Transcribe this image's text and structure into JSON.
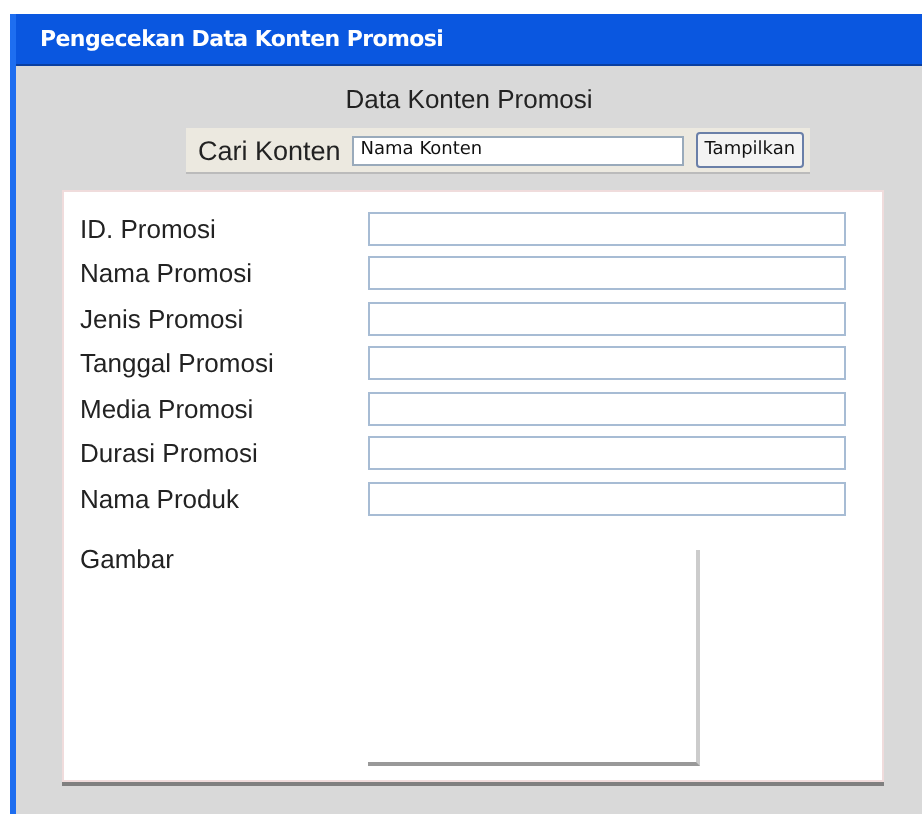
{
  "window": {
    "title": "Pengecekan Data Konten Promosi"
  },
  "heading": "Data Konten Promosi",
  "search": {
    "label": "Cari Konten",
    "value": "Nama Konten",
    "button": "Tampilkan"
  },
  "fields": [
    {
      "label": "ID. Promosi"
    },
    {
      "label": "Nama Promosi"
    },
    {
      "label": "Jenis Promosi"
    },
    {
      "label": "Tanggal Promosi"
    },
    {
      "label": "Media Promosi"
    },
    {
      "label": "Durasi Promosi"
    },
    {
      "label": "Nama Produk"
    }
  ],
  "image_field": {
    "label": "Gambar"
  }
}
